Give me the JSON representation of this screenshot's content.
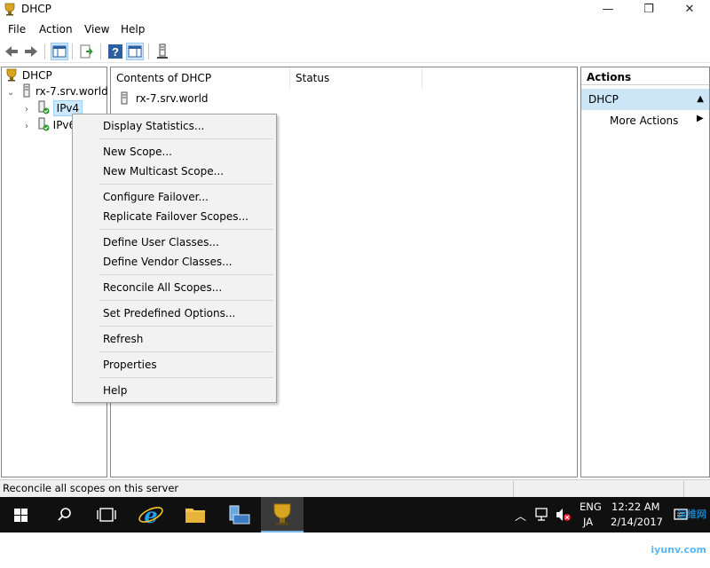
{
  "window": {
    "title": "DHCP",
    "minimize": "—",
    "maximize": "❐",
    "close": "✕"
  },
  "menubar": [
    "File",
    "Action",
    "View",
    "Help"
  ],
  "tree": {
    "root": "DHCP",
    "server": "rx-7.srv.world",
    "ipv4": "IPv4",
    "ipv6": "IPv6"
  },
  "list": {
    "columns": [
      "Contents of DHCP",
      "Status"
    ],
    "rows": [
      {
        "name": "rx-7.srv.world",
        "status": ""
      }
    ]
  },
  "actions": {
    "title": "Actions",
    "section": "DHCP",
    "more": "More Actions"
  },
  "context_menu": {
    "items": [
      "Display Statistics...",
      "New Scope...",
      "New Multicast Scope...",
      "Configure Failover...",
      "Replicate Failover Scopes...",
      "Define User Classes...",
      "Define Vendor Classes...",
      "Reconcile All Scopes...",
      "Set Predefined Options...",
      "Refresh",
      "Properties",
      "Help"
    ]
  },
  "statusbar": {
    "text": "Reconcile all scopes on this server"
  },
  "taskbar": {
    "lang_top": "ENG",
    "lang_bottom": "JA",
    "time": "12:22 AM",
    "date": "2/14/2017",
    "watermark": "运维网 iyunv.com"
  },
  "colors": {
    "selection": "#cce8ff",
    "accent": "#0078d7",
    "taskbar": "#101010"
  }
}
